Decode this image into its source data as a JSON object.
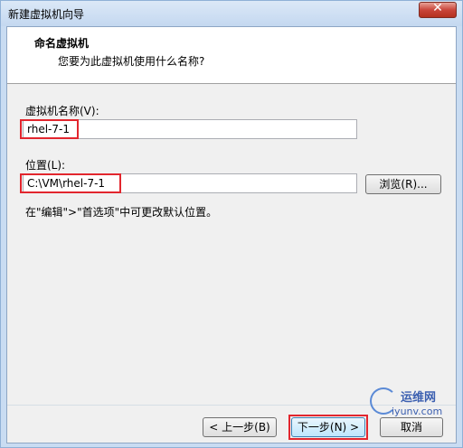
{
  "window": {
    "title": "新建虚拟机向导",
    "close_label": "✕"
  },
  "header": {
    "title": "命名虚拟机",
    "subtitle": "您要为此虚拟机使用什么名称?"
  },
  "form": {
    "name_label": "虚拟机名称(V):",
    "name_value": "rhel-7-1",
    "location_label": "位置(L):",
    "location_value": "C:\\VM\\rhel-7-1",
    "browse_label": "浏览(R)...",
    "hint": "在\"编辑\">\"首选项\"中可更改默认位置。"
  },
  "footer": {
    "back_label": "< 上一步(B)",
    "next_label": "下一步(N) >",
    "cancel_label": "取消"
  },
  "watermark": {
    "line1": "运维网",
    "line2": "iyunv.com"
  },
  "colors": {
    "highlight": "#e2262e",
    "title_bar": "#c4d8f0",
    "dialog_bg": "#f0f0f0"
  }
}
